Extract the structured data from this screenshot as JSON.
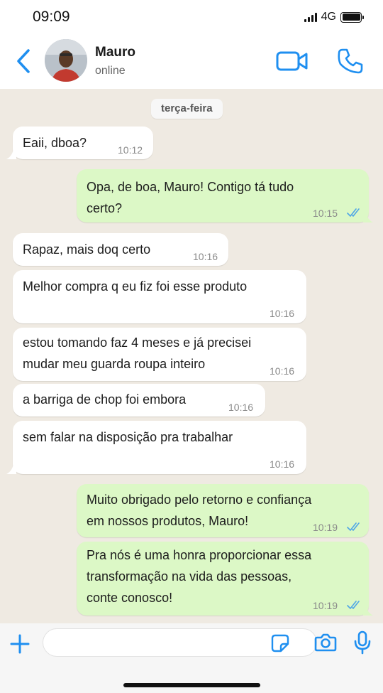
{
  "status_bar": {
    "time": "09:09",
    "network": "4G"
  },
  "contact": {
    "name": "Mauro",
    "status": "online"
  },
  "chat": {
    "date_label": "terça-feira",
    "messages": [
      {
        "direction": "in",
        "text": "Eaii, dboa?",
        "time": "10:12"
      },
      {
        "direction": "out",
        "text": "Opa, de boa, Mauro! Contigo tá tudo\ncerto?",
        "time": "10:15",
        "read": true
      },
      {
        "direction": "in",
        "text": "Rapaz, mais doq certo",
        "time": "10:16"
      },
      {
        "direction": "in",
        "text": "Melhor compra q eu fiz foi esse produto",
        "time": "10:16"
      },
      {
        "direction": "in",
        "text": "estou tomando faz 4 meses e já precisei\nmudar meu guarda roupa inteiro",
        "time": "10:16"
      },
      {
        "direction": "in",
        "text": "a barriga de chop foi embora",
        "time": "10:16"
      },
      {
        "direction": "in",
        "text": "sem falar na disposição pra trabalhar",
        "time": "10:16"
      },
      {
        "direction": "out",
        "text": "Muito obrigado pelo retorno e confiança\nem nossos produtos, Mauro!",
        "time": "10:19",
        "read": true
      },
      {
        "direction": "out",
        "text": "Pra nós é uma honra proporcionar essa\ntransformação na vida das pessoas,\nconte conosco!",
        "time": "10:19",
        "read": true
      }
    ]
  },
  "composer": {
    "value": ""
  },
  "colors": {
    "accent": "#1f8ff0",
    "chat_background": "#efeae2",
    "incoming_bubble": "#ffffff",
    "outgoing_bubble": "#dcf8c6",
    "read_ticks": "#4fa6e6"
  },
  "icons": [
    "back-icon",
    "video-call-icon",
    "voice-call-icon",
    "plus-icon",
    "sticker-icon",
    "camera-icon",
    "mic-icon"
  ]
}
